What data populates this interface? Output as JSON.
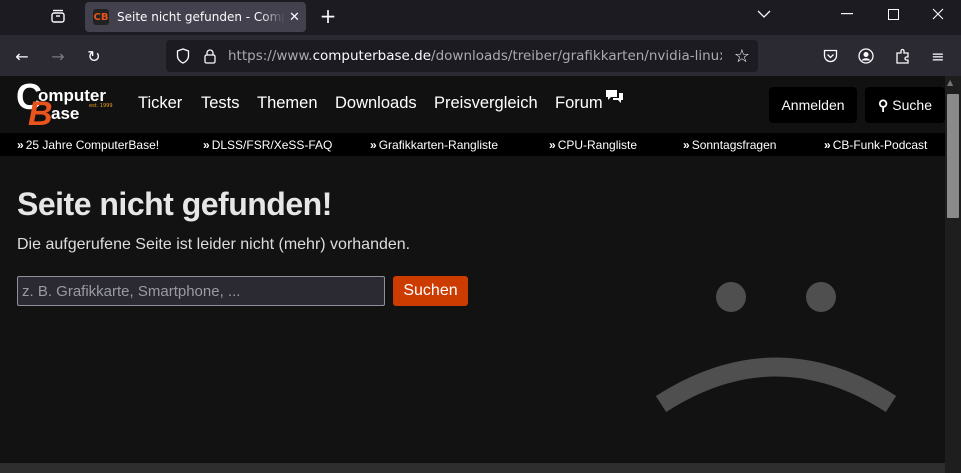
{
  "browser": {
    "tab_title": "Seite nicht gefunden - ComputerBase",
    "favicon_text": "CB",
    "url_prefix": "https://www.",
    "url_domain": "computerbase.de",
    "url_path": "/downloads/treiber/grafikkarten/nvidia-linux-display"
  },
  "site": {
    "logo_line1": "Computer",
    "logo_line2": "Base",
    "logo_est": "est. 1999",
    "nav": [
      "Ticker",
      "Tests",
      "Themen",
      "Downloads",
      "Preisvergleich",
      "Forum"
    ],
    "login_label": "Anmelden",
    "search_label": "Suche",
    "links": [
      "25 Jahre ComputerBase!",
      "DLSS/FSR/XeSS-FAQ",
      "Grafikkarten-Rangliste",
      "CPU-Rangliste",
      "Sonntagsfragen",
      "CB-Funk-Podcast"
    ]
  },
  "main": {
    "title": "Seite nicht gefunden!",
    "subtitle": "Die aufgerufene Seite ist leider nicht (mehr) vorhanden.",
    "search_placeholder": "z. B. Grafikkarte, Smartphone, ...",
    "search_button": "Suchen"
  },
  "colors": {
    "accent": "#cc3c00",
    "smiley": "#4f4f4f"
  }
}
